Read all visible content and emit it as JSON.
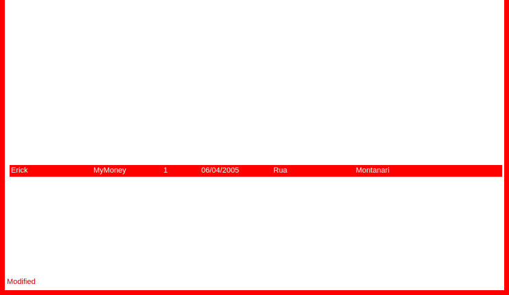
{
  "colors": {
    "frame": "#ff0000",
    "panel_background": "#ffffff",
    "selected_row_background": "#ff0000",
    "selected_row_text": "#ffffff",
    "status_text": "#cc0000"
  },
  "record": {
    "name": "Erick",
    "app": "MyMoney",
    "number": "1",
    "date": "06/04/2005",
    "street": "Rua",
    "surname": "Montanari"
  },
  "status": {
    "text": "Modified"
  }
}
